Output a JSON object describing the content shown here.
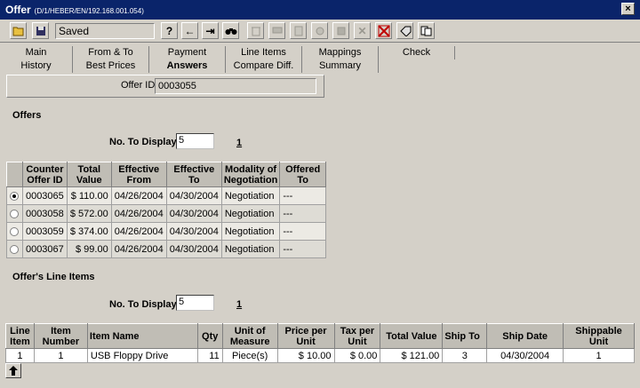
{
  "window": {
    "title": "Offer",
    "subtitle": "(D/1/HEBER/EN/192.168.001.054)",
    "close": "×"
  },
  "toolbar": {
    "status_value": "Saved",
    "buttons": [
      {
        "name": "open-folder-icon",
        "glyph": "📂",
        "enabled": true
      },
      {
        "name": "save-icon",
        "glyph": "💾",
        "enabled": true
      },
      {
        "name": "help-icon",
        "glyph": "?",
        "enabled": true
      },
      {
        "name": "back-arrow-icon",
        "glyph": "←",
        "enabled": true
      },
      {
        "name": "exit-icon",
        "glyph": "⇥",
        "enabled": true
      },
      {
        "name": "find-binoculars-icon",
        "glyph": "⌕",
        "enabled": true
      },
      {
        "name": "delete-trash-icon",
        "glyph": "🗑",
        "enabled": false
      },
      {
        "name": "comment-icon",
        "glyph": "✎",
        "enabled": false
      },
      {
        "name": "check-doc-icon",
        "glyph": "✓",
        "enabled": false
      },
      {
        "name": "hand-icon",
        "glyph": "✋",
        "enabled": false
      },
      {
        "name": "transfer-icon",
        "glyph": "⇄",
        "enabled": false
      },
      {
        "name": "cancel-x-icon",
        "glyph": "✕",
        "enabled": false
      },
      {
        "name": "grid-x-icon",
        "glyph": "⊠",
        "enabled": true
      },
      {
        "name": "tag-icon",
        "glyph": "◈",
        "enabled": true
      },
      {
        "name": "copy-icon",
        "glyph": "⧉",
        "enabled": true
      }
    ]
  },
  "tabs": {
    "row1": [
      "Main",
      "From & To",
      "Payment",
      "Line Items",
      "Mappings",
      "Check"
    ],
    "row2": [
      "History",
      "Best Prices",
      "Answers",
      "Compare Diff.",
      "Summary"
    ],
    "active": "Answers"
  },
  "offer_id": {
    "label": "Offer ID",
    "value": "0003055"
  },
  "offers": {
    "title": "Offers",
    "display_label": "No. To Display :",
    "display_value": "5",
    "page": "1",
    "columns": [
      "Counter Offer ID",
      "Total Value",
      "Effective From",
      "Effective To",
      "Modality of Negotiation",
      "Offered To"
    ],
    "rows": [
      {
        "selected": true,
        "id": "0003065",
        "total": "$ 110.00",
        "from": "04/26/2004",
        "to": "04/30/2004",
        "modality": "Negotiation",
        "offered_to": "---"
      },
      {
        "selected": false,
        "id": "0003058",
        "total": "$ 572.00",
        "from": "04/26/2004",
        "to": "04/30/2004",
        "modality": "Negotiation",
        "offered_to": "---"
      },
      {
        "selected": false,
        "id": "0003059",
        "total": "$ 374.00",
        "from": "04/26/2004",
        "to": "04/30/2004",
        "modality": "Negotiation",
        "offered_to": "---"
      },
      {
        "selected": false,
        "id": "0003067",
        "total": "$ 99.00",
        "from": "04/26/2004",
        "to": "04/30/2004",
        "modality": "Negotiation",
        "offered_to": "---"
      }
    ]
  },
  "line_items": {
    "title": "Offer's Line Items",
    "display_label": "No. To Display :",
    "display_value": "5",
    "page": "1",
    "columns": [
      "Line Item",
      "Item Number",
      "Item Name",
      "Qty",
      "Unit of Measure",
      "Price per Unit",
      "Tax per Unit",
      "Total Value",
      "Ship To",
      "Ship Date",
      "Shippable Unit"
    ],
    "rows": [
      {
        "line": "1",
        "number": "1",
        "name": "USB Floppy Drive",
        "qty": "11",
        "uom": "Piece(s)",
        "price": "$ 10.00",
        "tax": "$ 0.00",
        "total": "$ 121.00",
        "ship_to": "3",
        "ship_date": "04/30/2004",
        "shippable": "1"
      }
    ]
  },
  "scroll_up": "🡑"
}
